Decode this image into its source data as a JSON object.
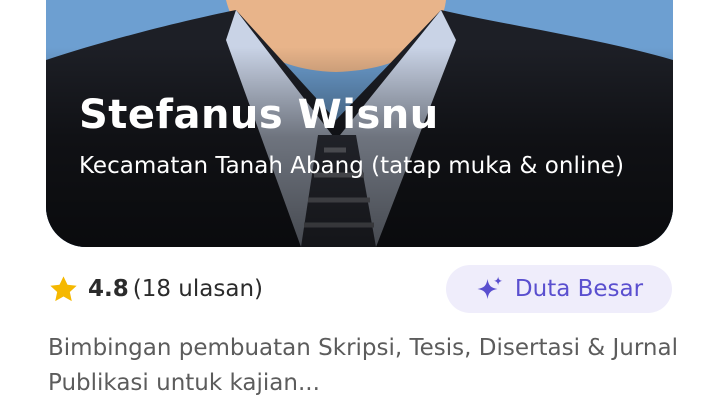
{
  "profile": {
    "name": "Stefanus Wisnu",
    "location": "Kecamatan Tanah Abang (tatap muka & online)",
    "rating_value": "4.8",
    "rating_count": "(18 ulasan)",
    "badge_label": "Duta Besar",
    "description": "Bimbingan pembuatan Skripsi, Tesis, Disertasi & Jurnal Publikasi untuk kajian..."
  },
  "icons": {
    "rating": "star-icon",
    "badge": "sparkle-icon"
  },
  "colors": {
    "photo_background": "#6d9fd1",
    "star": "#f5b800",
    "badge_background": "#efedfb",
    "badge_text": "#5a4fcf",
    "description_text": "#5c5c5c"
  }
}
